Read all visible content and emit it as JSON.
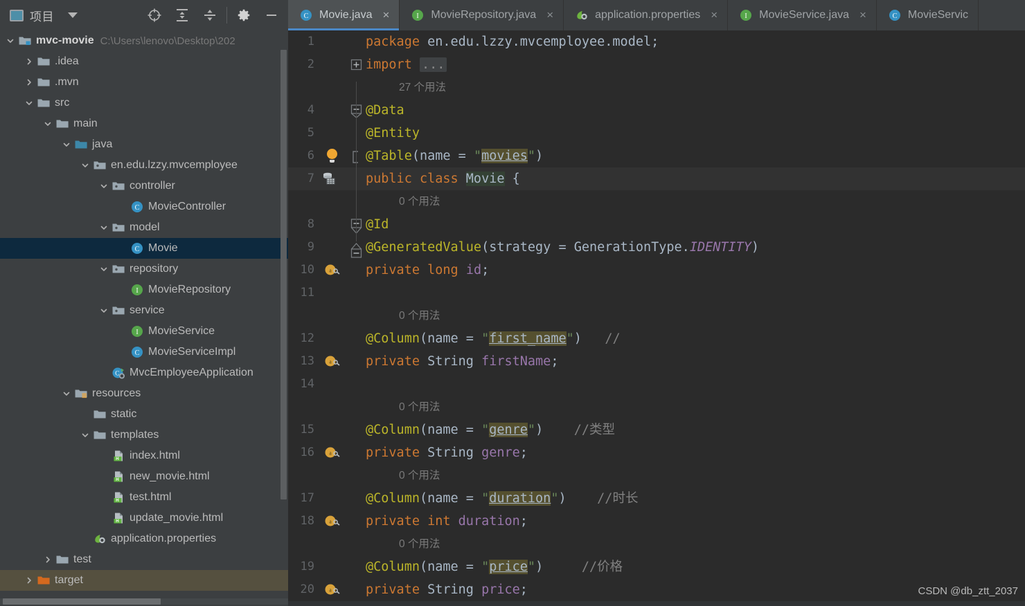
{
  "project_panel": {
    "title": "项目",
    "icon": "project-window-icon",
    "dropdown_icon": "chevron-down-icon",
    "toolbar": [
      {
        "name": "locate-icon",
        "label": "Select Opened File"
      },
      {
        "name": "expand-all-icon",
        "label": "Expand All"
      },
      {
        "name": "collapse-all-icon",
        "label": "Collapse All"
      },
      {
        "name": "settings-gear-icon",
        "label": "Settings"
      },
      {
        "name": "minimize-icon",
        "label": "Hide"
      }
    ]
  },
  "tree": [
    {
      "label": "mvc-movie",
      "path": "C:\\Users\\lenovo\\Desktop\\202",
      "depth": 0,
      "arrow": "down",
      "icon": "module-folder-icon",
      "bold": true,
      "state": "normal"
    },
    {
      "label": ".idea",
      "depth": 1,
      "arrow": "right",
      "icon": "folder-icon",
      "state": "normal"
    },
    {
      "label": ".mvn",
      "depth": 1,
      "arrow": "right",
      "icon": "folder-icon",
      "state": "normal"
    },
    {
      "label": "src",
      "depth": 1,
      "arrow": "down",
      "icon": "folder-icon",
      "state": "normal"
    },
    {
      "label": "main",
      "depth": 2,
      "arrow": "down",
      "icon": "folder-icon",
      "state": "normal"
    },
    {
      "label": "java",
      "depth": 3,
      "arrow": "down",
      "icon": "source-root-icon",
      "state": "normal"
    },
    {
      "label": "en.edu.lzzy.mvcemployee",
      "depth": 4,
      "arrow": "down",
      "icon": "package-icon",
      "state": "normal"
    },
    {
      "label": "controller",
      "depth": 5,
      "arrow": "down",
      "icon": "package-icon",
      "state": "normal"
    },
    {
      "label": "MovieController",
      "depth": 6,
      "arrow": "none",
      "icon": "java-class-icon",
      "state": "normal"
    },
    {
      "label": "model",
      "depth": 5,
      "arrow": "down",
      "icon": "package-icon",
      "state": "normal"
    },
    {
      "label": "Movie",
      "depth": 6,
      "arrow": "none",
      "icon": "java-class-icon",
      "state": "selected"
    },
    {
      "label": "repository",
      "depth": 5,
      "arrow": "down",
      "icon": "package-icon",
      "state": "normal"
    },
    {
      "label": "MovieRepository",
      "depth": 6,
      "arrow": "none",
      "icon": "java-interface-icon",
      "state": "normal"
    },
    {
      "label": "service",
      "depth": 5,
      "arrow": "down",
      "icon": "package-icon",
      "state": "normal"
    },
    {
      "label": "MovieService",
      "depth": 6,
      "arrow": "none",
      "icon": "java-interface-icon",
      "state": "normal"
    },
    {
      "label": "MovieServiceImpl",
      "depth": 6,
      "arrow": "none",
      "icon": "java-class-icon",
      "state": "normal"
    },
    {
      "label": "MvcEmployeeApplication",
      "depth": 5,
      "arrow": "none",
      "icon": "spring-boot-run-icon",
      "state": "normal"
    },
    {
      "label": "resources",
      "depth": 3,
      "arrow": "down",
      "icon": "resource-root-icon",
      "state": "normal"
    },
    {
      "label": "static",
      "depth": 4,
      "arrow": "none",
      "icon": "folder-icon",
      "state": "normal"
    },
    {
      "label": "templates",
      "depth": 4,
      "arrow": "down",
      "icon": "folder-icon",
      "state": "normal"
    },
    {
      "label": "index.html",
      "depth": 5,
      "arrow": "none",
      "icon": "html-file-icon",
      "state": "normal"
    },
    {
      "label": "new_movie.html",
      "depth": 5,
      "arrow": "none",
      "icon": "html-file-icon",
      "state": "normal"
    },
    {
      "label": "test.html",
      "depth": 5,
      "arrow": "none",
      "icon": "html-file-icon",
      "state": "normal"
    },
    {
      "label": "update_movie.html",
      "depth": 5,
      "arrow": "none",
      "icon": "html-file-icon",
      "state": "normal"
    },
    {
      "label": "application.properties",
      "depth": 4,
      "arrow": "none",
      "icon": "spring-properties-icon",
      "state": "normal"
    },
    {
      "label": "test",
      "depth": 2,
      "arrow": "right",
      "icon": "folder-icon",
      "state": "normal"
    },
    {
      "label": "target",
      "depth": 1,
      "arrow": "right",
      "icon": "excluded-folder-icon",
      "state": "hovered"
    }
  ],
  "tabs": [
    {
      "label": "Movie.java",
      "icon": "java-class-icon",
      "active": true,
      "close_icon": "close-icon"
    },
    {
      "label": "MovieRepository.java",
      "icon": "java-interface-icon",
      "active": false,
      "close_icon": "close-icon"
    },
    {
      "label": "application.properties",
      "icon": "spring-properties-icon",
      "active": false,
      "close_icon": "close-icon"
    },
    {
      "label": "MovieService.java",
      "icon": "java-interface-icon",
      "active": false,
      "close_icon": "close-icon"
    },
    {
      "label": "MovieServic",
      "icon": "java-class-icon",
      "active": false,
      "close_icon": ""
    }
  ],
  "editor": {
    "watermark": "CSDN @db_ztt_2037",
    "lines": [
      {
        "num": "1",
        "kind": "code",
        "fold": "",
        "gutter": "",
        "hl": false,
        "tokens": [
          {
            "t": "package ",
            "c": "kw"
          },
          {
            "t": "en.edu.lzzy.mvcemployee.model;",
            "c": "pkg"
          }
        ]
      },
      {
        "num": "2",
        "kind": "code",
        "fold": "plus",
        "gutter": "",
        "hl": false,
        "tokens": [
          {
            "t": "import ",
            "c": "kw"
          },
          {
            "t": "...",
            "c": "fold-ph"
          }
        ]
      },
      {
        "num": "",
        "kind": "hint",
        "hint": "27 个用法"
      },
      {
        "num": "4",
        "kind": "code",
        "fold": "minus",
        "gutter": "",
        "hl": false,
        "tokens": [
          {
            "t": "@Data",
            "c": "ann"
          }
        ]
      },
      {
        "num": "5",
        "kind": "code",
        "fold": "",
        "gutter": "",
        "hl": false,
        "tokens": [
          {
            "t": "@Entity",
            "c": "ann"
          }
        ]
      },
      {
        "num": "6",
        "kind": "code",
        "fold": "brkt",
        "gutter": "bulb",
        "hl": false,
        "tokens": [
          {
            "t": "@Table",
            "c": "ann"
          },
          {
            "t": "(name = ",
            "c": "plain"
          },
          {
            "t": "\"",
            "c": "str"
          },
          {
            "t": "movies",
            "c": "hl-str"
          },
          {
            "t": "\"",
            "c": "str"
          },
          {
            "t": ")",
            "c": "plain"
          }
        ]
      },
      {
        "num": "7",
        "kind": "code",
        "fold": "",
        "gutter": "database",
        "hl": true,
        "tokens": [
          {
            "t": "public ",
            "c": "kw"
          },
          {
            "t": "class ",
            "c": "kw"
          },
          {
            "t": "Movie",
            "c": "hl-id"
          },
          {
            "t": " {",
            "c": "plain"
          }
        ]
      },
      {
        "num": "",
        "kind": "hint",
        "hint": "0 个用法"
      },
      {
        "num": "8",
        "kind": "code",
        "fold": "dn",
        "gutter": "",
        "hl": false,
        "tokens": [
          {
            "t": "@Id",
            "c": "ann"
          }
        ]
      },
      {
        "num": "9",
        "kind": "code",
        "fold": "up",
        "gutter": "",
        "hl": false,
        "tokens": [
          {
            "t": "@GeneratedValue",
            "c": "ann"
          },
          {
            "t": "(strategy = GenerationType.",
            "c": "plain"
          },
          {
            "t": "IDENTITY",
            "c": "ital"
          },
          {
            "t": ")",
            "c": "plain"
          }
        ]
      },
      {
        "num": "10",
        "kind": "code",
        "fold": "",
        "gutter": "bean",
        "hl": false,
        "tokens": [
          {
            "t": "private ",
            "c": "kw"
          },
          {
            "t": "long ",
            "c": "kw"
          },
          {
            "t": "id",
            "c": "fld"
          },
          {
            "t": ";",
            "c": "plain"
          }
        ]
      },
      {
        "num": "11",
        "kind": "code",
        "fold": "",
        "gutter": "",
        "hl": false,
        "tokens": []
      },
      {
        "num": "",
        "kind": "hint",
        "hint": "0 个用法"
      },
      {
        "num": "12",
        "kind": "code",
        "fold": "",
        "gutter": "",
        "hl": false,
        "tokens": [
          {
            "t": "@Column",
            "c": "ann"
          },
          {
            "t": "(name = ",
            "c": "plain"
          },
          {
            "t": "\"",
            "c": "str"
          },
          {
            "t": "first_name",
            "c": "hl-str"
          },
          {
            "t": "\"",
            "c": "str"
          },
          {
            "t": ")",
            "c": "plain"
          },
          {
            "t": "   ",
            "c": "plain"
          },
          {
            "t": "//",
            "c": "cmt"
          }
        ]
      },
      {
        "num": "13",
        "kind": "code",
        "fold": "",
        "gutter": "bean",
        "hl": false,
        "tokens": [
          {
            "t": "private ",
            "c": "kw"
          },
          {
            "t": "String ",
            "c": "cls"
          },
          {
            "t": "firstName",
            "c": "fld"
          },
          {
            "t": ";",
            "c": "plain"
          }
        ]
      },
      {
        "num": "14",
        "kind": "code",
        "fold": "",
        "gutter": "",
        "hl": false,
        "tokens": []
      },
      {
        "num": "",
        "kind": "hint",
        "hint": "0 个用法"
      },
      {
        "num": "15",
        "kind": "code",
        "fold": "",
        "gutter": "",
        "hl": false,
        "tokens": [
          {
            "t": "@Column",
            "c": "ann"
          },
          {
            "t": "(name = ",
            "c": "plain"
          },
          {
            "t": "\"",
            "c": "str"
          },
          {
            "t": "genre",
            "c": "hl-str"
          },
          {
            "t": "\"",
            "c": "str"
          },
          {
            "t": ")",
            "c": "plain"
          },
          {
            "t": "    ",
            "c": "plain"
          },
          {
            "t": "//类型",
            "c": "cmt"
          }
        ]
      },
      {
        "num": "16",
        "kind": "code",
        "fold": "",
        "gutter": "bean",
        "hl": false,
        "tokens": [
          {
            "t": "private ",
            "c": "kw"
          },
          {
            "t": "String ",
            "c": "cls"
          },
          {
            "t": "genre",
            "c": "fld"
          },
          {
            "t": ";",
            "c": "plain"
          }
        ]
      },
      {
        "num": "",
        "kind": "hint",
        "hint": "0 个用法"
      },
      {
        "num": "17",
        "kind": "code",
        "fold": "",
        "gutter": "",
        "hl": false,
        "tokens": [
          {
            "t": "@Column",
            "c": "ann"
          },
          {
            "t": "(name = ",
            "c": "plain"
          },
          {
            "t": "\"",
            "c": "str"
          },
          {
            "t": "duration",
            "c": "hl-str"
          },
          {
            "t": "\"",
            "c": "str"
          },
          {
            "t": ")",
            "c": "plain"
          },
          {
            "t": "    ",
            "c": "plain"
          },
          {
            "t": "//时长",
            "c": "cmt"
          }
        ]
      },
      {
        "num": "18",
        "kind": "code",
        "fold": "",
        "gutter": "bean",
        "hl": false,
        "tokens": [
          {
            "t": "private ",
            "c": "kw"
          },
          {
            "t": "int ",
            "c": "kw"
          },
          {
            "t": "duration",
            "c": "fld"
          },
          {
            "t": ";",
            "c": "plain"
          }
        ]
      },
      {
        "num": "",
        "kind": "hint",
        "hint": "0 个用法"
      },
      {
        "num": "19",
        "kind": "code",
        "fold": "",
        "gutter": "",
        "hl": false,
        "tokens": [
          {
            "t": "@Column",
            "c": "ann"
          },
          {
            "t": "(name = ",
            "c": "plain"
          },
          {
            "t": "\"",
            "c": "str"
          },
          {
            "t": "price",
            "c": "hl-str"
          },
          {
            "t": "\"",
            "c": "str"
          },
          {
            "t": ")",
            "c": "plain"
          },
          {
            "t": "     ",
            "c": "plain"
          },
          {
            "t": "//价格",
            "c": "cmt"
          }
        ]
      },
      {
        "num": "20",
        "kind": "code",
        "fold": "",
        "gutter": "bean",
        "hl": false,
        "tokens": [
          {
            "t": "private ",
            "c": "kw"
          },
          {
            "t": "String ",
            "c": "cls"
          },
          {
            "t": "price",
            "c": "fld"
          },
          {
            "t": ";",
            "c": "plain"
          }
        ]
      }
    ]
  },
  "colors": {
    "accent_blue": "#4a88c7",
    "selection": "#0d293e",
    "hover": "#55503f",
    "editor_bg": "#2b2b2b",
    "panel_bg": "#3c3f41"
  }
}
